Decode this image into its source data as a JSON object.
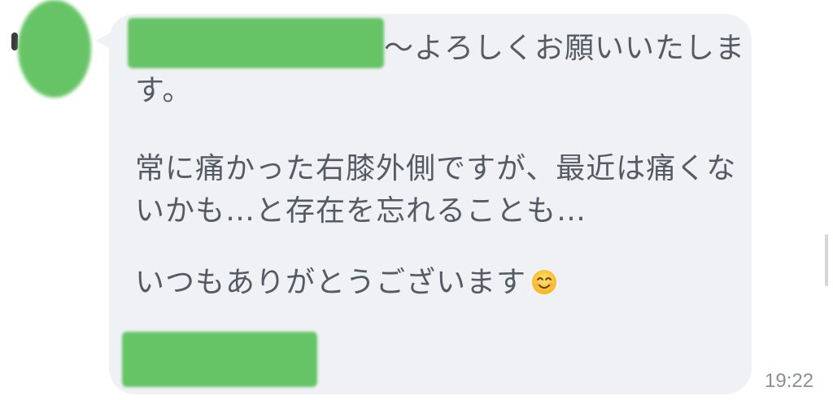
{
  "chat": {
    "message": {
      "line1": "〜よろしくお願いいたしま",
      "line2": "す。",
      "line3": "常に痛かった右膝外側ですが、最近は痛くな",
      "line4": "いかも…と存在を忘れることも…",
      "line5": "いつもありがとうございます",
      "emoji": "smiling-face-emoji",
      "timestamp": "19:22"
    },
    "colors": {
      "bubble": "#eff1f5",
      "redaction": "#66c466",
      "text": "#555b63",
      "timestamp": "#8a8f96"
    }
  }
}
